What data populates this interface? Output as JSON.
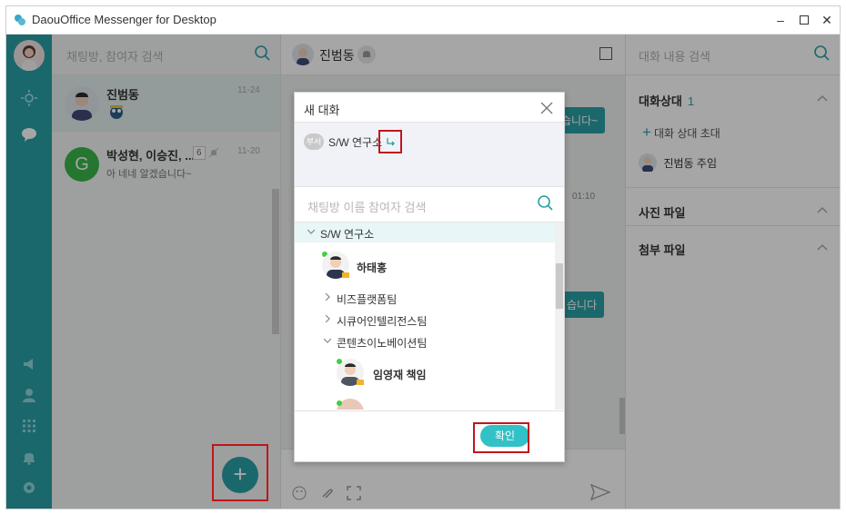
{
  "window": {
    "title": "DaouOffice Messenger for Desktop"
  },
  "chat_list": {
    "search_placeholder": "채팅방, 참여자 검색",
    "items": [
      {
        "name": "진범동",
        "time": "11-24",
        "preview": ""
      },
      {
        "name": "박성현, 이승진, ...",
        "count": "6",
        "time": "11-20",
        "preview": "아 네네 알겠습니다~",
        "avatar_letter": "G"
      }
    ]
  },
  "conversation": {
    "title": "진범동",
    "bubbles": [
      "습니다~",
      "습니다"
    ],
    "time": "01:10"
  },
  "right_panel": {
    "search_placeholder": "대화 내용 검색",
    "participants_title": "대화상대",
    "participants_count": "1",
    "invite_label": "대화 상대 초대",
    "member_name": "진범동 주임",
    "photos_title": "사진 파일",
    "attachments_title": "첨부 파일"
  },
  "dialog": {
    "title": "새 대화",
    "selected_chip_tag": "부서",
    "selected_chip_label": "S/W 연구소",
    "search_placeholder": "채팅방 이름 참여자 검색",
    "tree": {
      "root": "S/W 연구소",
      "leader": "하태홍",
      "teams": [
        "비즈플랫폼팀",
        "시큐어인텔리전스팀",
        "콘텐츠이노베이션팀"
      ],
      "member": "임영재 책임"
    },
    "confirm_label": "확인"
  },
  "colors": {
    "accent": "#2aa0a6",
    "highlight": "#c0161c",
    "confirm": "#31c1c7"
  }
}
